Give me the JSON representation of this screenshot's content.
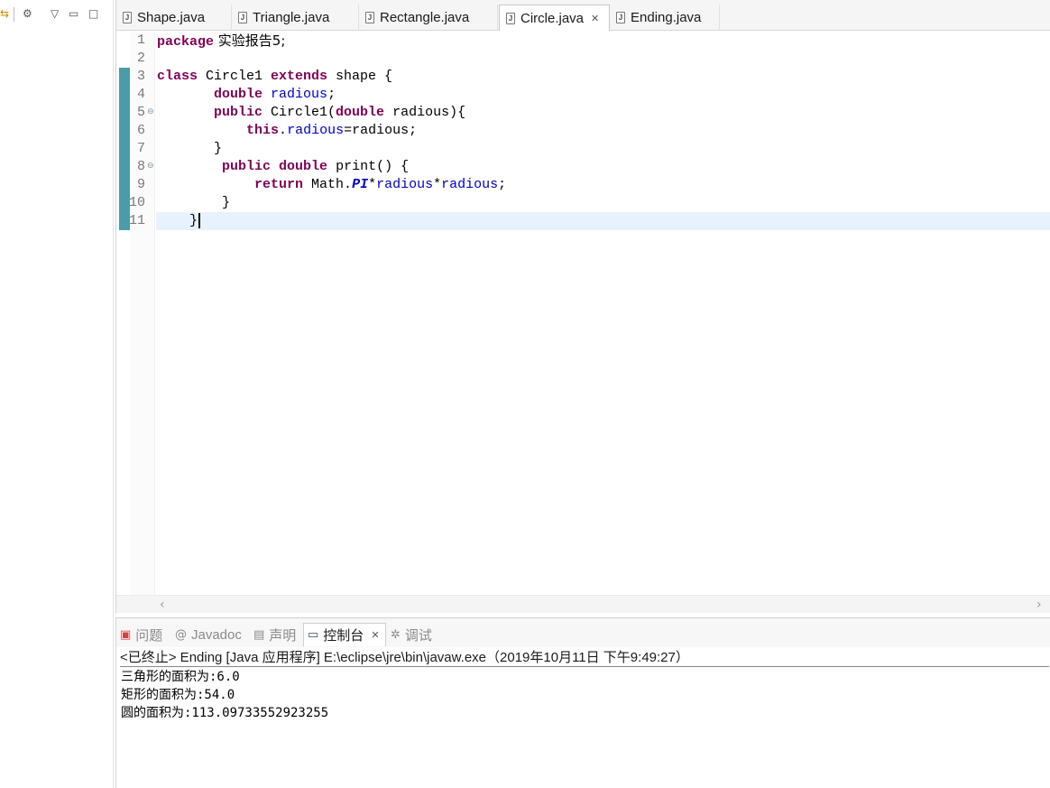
{
  "tabs": [
    {
      "label": "Shape.java",
      "active": false
    },
    {
      "label": "Triangle.java",
      "active": false
    },
    {
      "label": "Rectangle.java",
      "active": false
    },
    {
      "label": "Circle.java",
      "active": true
    },
    {
      "label": "Ending.java",
      "active": false
    }
  ],
  "editor": {
    "line_numbers": [
      "1",
      "2",
      "3",
      "4",
      "5",
      "6",
      "7",
      "8",
      "9",
      "10",
      "11"
    ],
    "lines": {
      "l1_kw": "package",
      "l1_rest": " 实验报告5;",
      "l3_kw1": "class",
      "l3_mid": " Circle1 ",
      "l3_kw2": "extends",
      "l3_rest": " shape {",
      "l4_kw": "double",
      "l4_fld": "radious",
      "l4_rest": ";",
      "l5_kw1": "public",
      "l5_mid": " Circle1(",
      "l5_kw2": "double",
      "l5_rest": " radious){",
      "l6_kw": "this",
      "l6_dot": ".",
      "l6_fld": "radious",
      "l6_rest": "=radious;",
      "l7": "}",
      "l8_kw1": "public",
      "l8_kw2": "double",
      "l8_rest": " print() {",
      "l9_kw": "return",
      "l9_mid": " Math.",
      "l9_sfld": "PI",
      "l9_star1": "*",
      "l9_fld1": "radious",
      "l9_star2": "*",
      "l9_fld2": "radious",
      "l9_rest": ";",
      "l10": "}",
      "l11": "}"
    }
  },
  "console_tabs": [
    {
      "label": "问题",
      "icon": "problems-icon",
      "active": false
    },
    {
      "label": "Javadoc",
      "icon": "at-icon",
      "active": false
    },
    {
      "label": "声明",
      "icon": "declaration-icon",
      "active": false
    },
    {
      "label": "控制台",
      "icon": "console-icon",
      "active": true
    },
    {
      "label": "调试",
      "icon": "debug-icon",
      "active": false
    }
  ],
  "console": {
    "header": "<已终止> Ending [Java 应用程序] E:\\eclipse\\jre\\bin\\javaw.exe（2019年10月11日 下午9:49:27）",
    "output": [
      "三角形的面积为:6.0",
      "矩形的面积为:54.0",
      "圆的面积为:113.09733552923255"
    ]
  },
  "colors": {
    "keyword": "#7f0055",
    "field": "#0000c0",
    "current_line": "#e8f2fe",
    "marker": "#4c9ba8"
  }
}
